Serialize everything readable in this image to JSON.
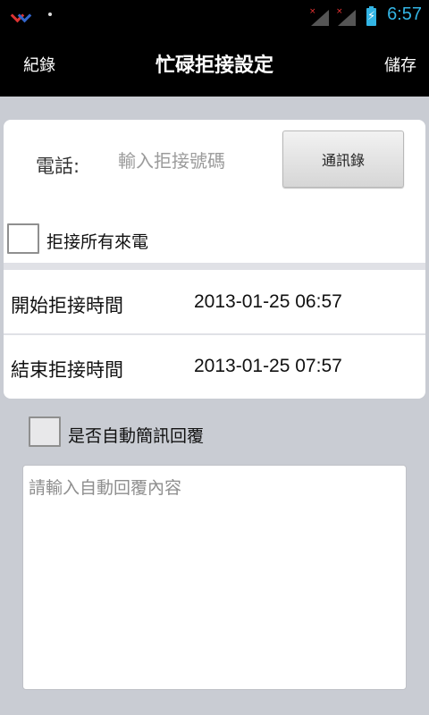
{
  "status_bar": {
    "time": "6:57",
    "notification_icons": [
      "bird-icon",
      "dot-icon"
    ],
    "signal_icons": [
      "signal-no-service-icon",
      "signal-no-service-icon"
    ],
    "battery_icon": "battery-charging-icon",
    "accent_color": "#33b5e5"
  },
  "header": {
    "left_label": "紀錄",
    "title": "忙碌拒接設定",
    "right_label": "儲存"
  },
  "form": {
    "phone_label": "電話:",
    "phone_placeholder": "輸入拒接號碼",
    "phone_value": "",
    "contacts_button": "通訊錄",
    "reject_all_label": "拒接所有來電",
    "reject_all_checked": false,
    "start_label": "開始拒接時間",
    "start_value": "2013-01-25 06:57",
    "end_label": "結束拒接時間",
    "end_value": "2013-01-25 07:57",
    "auto_reply_label": "是否自動簡訊回覆",
    "auto_reply_checked": false,
    "auto_reply_placeholder": "請輸入自動回覆內容",
    "auto_reply_value": ""
  }
}
